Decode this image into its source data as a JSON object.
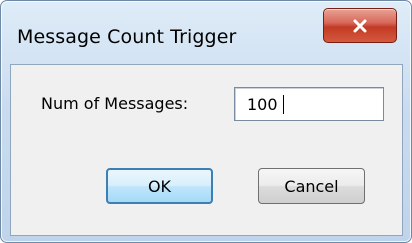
{
  "window": {
    "title": "Message Count Trigger"
  },
  "form": {
    "num_messages_label": "Num of Messages:",
    "num_messages_value": "100"
  },
  "buttons": {
    "ok_label": "OK",
    "cancel_label": "Cancel"
  },
  "colors": {
    "close_button": "#c9402b",
    "ok_focus_border": "#3c7fb1"
  }
}
